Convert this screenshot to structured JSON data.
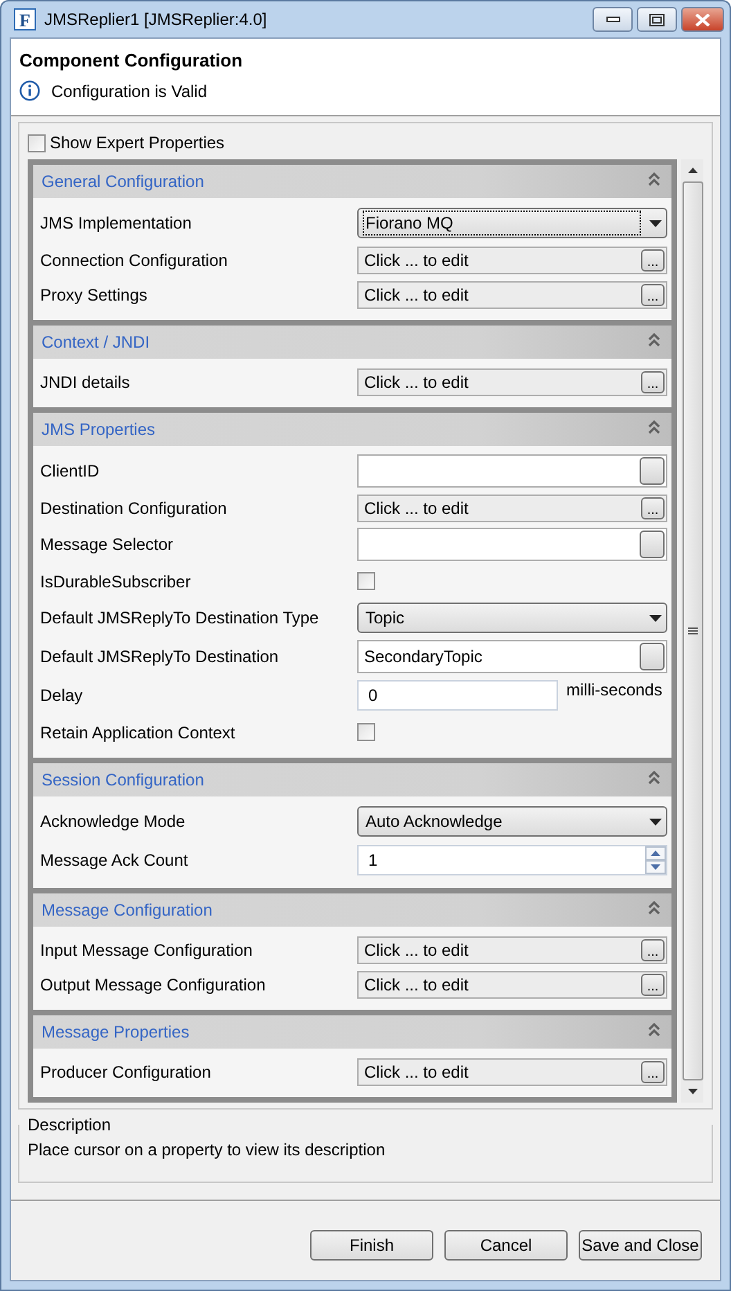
{
  "window": {
    "icon_letter": "F",
    "title": "JMSReplier1 [JMSReplier:4.0]"
  },
  "header": {
    "title": "Component Configuration",
    "status": "Configuration is Valid"
  },
  "expert": {
    "label": "Show Expert Properties",
    "checked": false
  },
  "sections": [
    {
      "title": "General Configuration",
      "expanded": true,
      "rows": [
        {
          "kind": "combo",
          "label": "JMS Implementation",
          "value": "Fiorano MQ",
          "focused": true
        },
        {
          "kind": "editor",
          "label": "Connection Configuration",
          "value": "Click ... to edit",
          "button": "..."
        },
        {
          "kind": "editor",
          "label": "Proxy Settings",
          "value": "Click ... to edit",
          "button": "..."
        }
      ]
    },
    {
      "title": "Context / JNDI",
      "expanded": true,
      "rows": [
        {
          "kind": "editor",
          "label": "JNDI details",
          "value": "Click ... to edit",
          "button": "..."
        }
      ]
    },
    {
      "title": "JMS Properties",
      "expanded": true,
      "rows": [
        {
          "kind": "text",
          "label": "ClientID"
        },
        {
          "kind": "editor",
          "label": "Destination Configuration",
          "value": "Click ... to edit",
          "button": "..."
        },
        {
          "kind": "text",
          "label": "Message Selector"
        },
        {
          "kind": "check",
          "label": "IsDurableSubscriber",
          "checked": false
        },
        {
          "kind": "combo",
          "label": "Default JMSReplyTo Destination Type",
          "value": "Topic",
          "focused": false
        },
        {
          "kind": "text",
          "label": "Default JMSReplyTo Destination",
          "value": "SecondaryTopic"
        },
        {
          "kind": "number",
          "label": "Delay",
          "value": "0",
          "unit": "milli-seconds"
        },
        {
          "kind": "check",
          "label": "Retain Application Context",
          "checked": false
        }
      ]
    },
    {
      "title": "Session Configuration",
      "expanded": true,
      "rows": [
        {
          "kind": "combo",
          "label": "Acknowledge Mode",
          "value": "Auto Acknowledge",
          "focused": false
        },
        {
          "kind": "spinner",
          "label": "Message Ack Count",
          "value": "1"
        }
      ]
    },
    {
      "title": "Message Configuration",
      "expanded": true,
      "rows": [
        {
          "kind": "editor",
          "label": "Input Message Configuration",
          "value": "Click ... to edit",
          "button": "..."
        },
        {
          "kind": "editor",
          "label": "Output Message Configuration",
          "value": "Click ... to edit",
          "button": "..."
        }
      ]
    },
    {
      "title": "Message Properties",
      "expanded": true,
      "rows": [
        {
          "kind": "editor",
          "label": "Producer Configuration",
          "value": "Click ... to edit",
          "button": "..."
        }
      ]
    }
  ],
  "description": {
    "title": "Description",
    "text": "Place cursor on a property to view its description"
  },
  "buttons": [
    "Finish",
    "Cancel",
    "Save and Close"
  ]
}
